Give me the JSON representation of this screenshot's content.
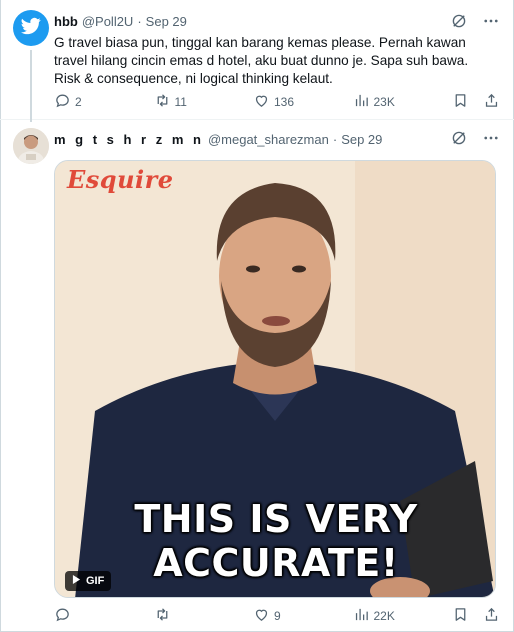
{
  "tweets": [
    {
      "name": "hbb",
      "handle": "@Poll2U",
      "separator": "·",
      "date": "Sep 29",
      "text": "G travel biasa pun, tinggal kan barang kemas please. Pernah kawan travel hilang cincin emas d hotel, aku buat dunno je. Sapa suh bawa. Risk & consequence, ni  logical thinking kelaut.",
      "avatar_icon": "twitter-bird-icon",
      "actions": {
        "replies": "2",
        "reposts": "11",
        "likes": "136",
        "views": "23K"
      }
    },
    {
      "name": "m g t s h r z m n",
      "handle": "@megat_sharezman",
      "separator": "·",
      "date": "Sep 29",
      "media": {
        "brand": "Esquire",
        "caption_line1": "THIS IS VERY",
        "caption_line2": "ACCURATE!",
        "badge": "GIF"
      },
      "actions": {
        "replies": "",
        "reposts": "",
        "likes": "9",
        "views": "22K"
      }
    }
  ],
  "colors": {
    "accent": "#1d9bf0",
    "muted": "#536471",
    "text": "#0f1419",
    "brand_red": "#e04a3a"
  },
  "icons": [
    "grok-icon",
    "more-icon",
    "reply-icon",
    "repost-icon",
    "like-icon",
    "views-icon",
    "bookmark-icon",
    "share-icon",
    "play-icon"
  ]
}
